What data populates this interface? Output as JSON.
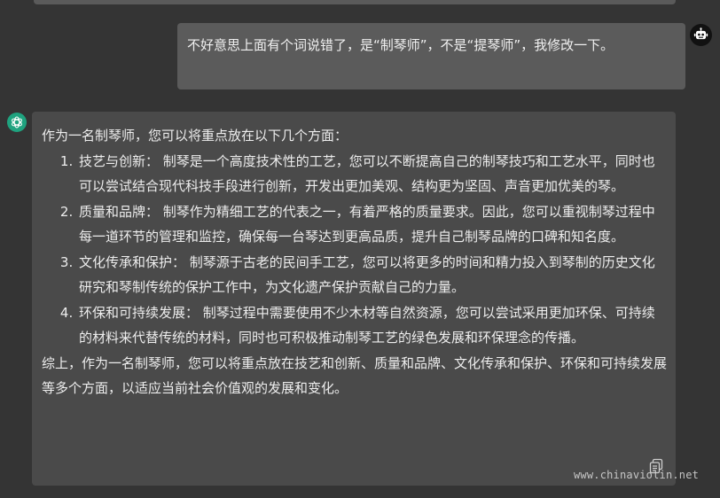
{
  "user_message": "不好意思上面有个词说错了，是“制琴师”，不是“提琴师”，我修改一下。",
  "assistant": {
    "intro": "作为一名制琴师，您可以将重点放在以下几个方面：",
    "items": [
      "技艺与创新：  制琴是一个高度技术性的工艺，您可以不断提高自己的制琴技巧和工艺水平，同时也可以尝试结合现代科技手段进行创新，开发出更加美观、结构更为坚固、声音更加优美的琴。",
      "质量和品牌：  制琴作为精细工艺的代表之一，有着严格的质量要求。因此，您可以重视制琴过程中每一道环节的管理和监控，确保每一台琴达到更高品质，提升自己制琴品牌的口碑和知名度。",
      "文化传承和保护：  制琴源于古老的民间手工艺，您可以将更多的时间和精力投入到琴制的历史文化研究和琴制传统的保护工作中，为文化遗产保护贡献自己的力量。",
      "环保和可持续发展：  制琴过程中需要使用不少木材等自然资源，您可以尝试采用更加环保、可持续的材料来代替传统的材料，同时也可积极推动制琴工艺的绿色发展和环保理念的传播。"
    ],
    "conclusion": "综上，作为一名制琴师，您可以将重点放在技艺和创新、质量和品牌、文化传承和保护、环保和可持续发展等多个方面，以适应当前社会价值观的发展和变化。"
  },
  "watermark": "www.chinaviolin.net",
  "icons": {
    "user_avatar": "robot-icon",
    "assistant_avatar": "openai-logo-icon",
    "copy": "copy-icon"
  },
  "colors": {
    "background": "#343434",
    "user_bubble": "#5b5b5b",
    "assistant_bubble": "#4a4a4a",
    "assistant_avatar": "#1fa37f"
  }
}
